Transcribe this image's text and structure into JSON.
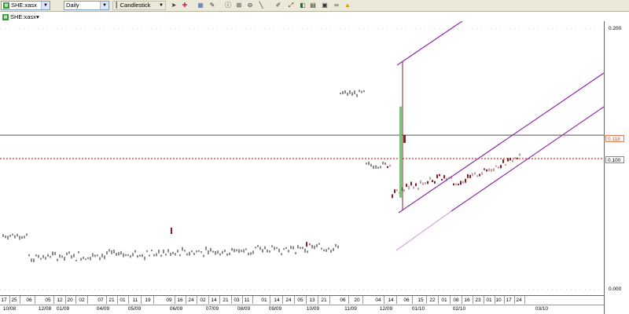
{
  "toolbar": {
    "symbol": "SHE:xasx",
    "period": "Daily",
    "chart_type": "Candlestick",
    "icons": [
      "cursor-icon",
      "crosshair-icon",
      "grid-icon",
      "draw-icon",
      "info-icon",
      "zoom-in-icon",
      "zoom-out-icon",
      "line-tool-icon",
      "pen-icon",
      "auto-scale-icon",
      "indicator-icon",
      "save-icon",
      "print-icon",
      "link-icon",
      "alert-icon"
    ]
  },
  "legend": {
    "symbol": "SHE:xasx"
  },
  "colors": {
    "up_candle": "#c7a0a0",
    "down_candle": "#8b1f1f",
    "bar": "#8a8a8a",
    "channel": "#8e2aa5",
    "channel_lower_ext": "#d7a6e0",
    "resistance": "#555555",
    "current": "#d00000"
  },
  "chart_data": {
    "type": "candlestick",
    "y_ticks": [
      "0.200",
      "0.000"
    ],
    "ylim": [
      0.0,
      0.2
    ],
    "price_tags": [
      {
        "label": "0.118",
        "color": "#e07a50"
      },
      {
        "label": "0.100",
        "color": "#888888"
      }
    ],
    "horizontal_lines": [
      {
        "value": 0.118,
        "style": "solid"
      },
      {
        "value": 0.1,
        "style": "dotted"
      }
    ],
    "x_day_ticks": [
      "17",
      "25",
      "06",
      "05",
      "12",
      "20",
      "02",
      "07",
      "21",
      "01",
      "11",
      "19",
      "09",
      "16",
      "24",
      "02",
      "14",
      "21",
      "03",
      "11",
      "01",
      "14",
      "24",
      "05",
      "13",
      "21",
      "06",
      "20",
      "04",
      "14",
      "06",
      "15",
      "22",
      "01",
      "08",
      "16",
      "23",
      "01",
      "10",
      "17",
      "24"
    ],
    "x_month_ticks": [
      "10/08",
      "12/08",
      "01/09",
      "04/09",
      "05/09",
      "06/09",
      "07/09",
      "08/09",
      "09/09",
      "10/09",
      "11/09",
      "12/09",
      "01/10",
      "02/10",
      "03/10"
    ],
    "segments": [
      {
        "from": 0.0,
        "to": 0.05,
        "level": 0.041
      },
      {
        "from": 0.05,
        "to": 0.65,
        "level": 0.028
      },
      {
        "from": 0.65,
        "to": 0.7,
        "level": 0.15
      },
      {
        "from": 0.7,
        "to": 0.75,
        "level": 0.095
      },
      {
        "from": 0.75,
        "to": 0.87,
        "level": 0.076
      },
      {
        "from": 0.87,
        "to": 1.0,
        "level": 0.101
      }
    ]
  }
}
